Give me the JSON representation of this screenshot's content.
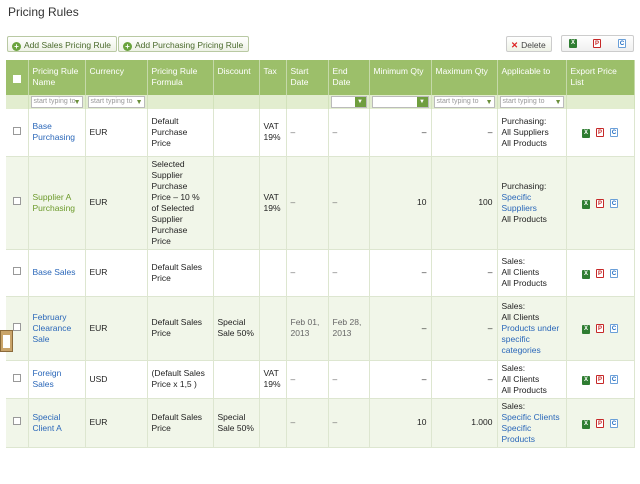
{
  "page": {
    "title": "Pricing Rules"
  },
  "toolbar": {
    "add_sales": "Add Sales Pricing Rule",
    "add_purchasing": "Add Purchasing Pricing Rule",
    "delete": "Delete",
    "export_icons": [
      "excel-icon",
      "pdf-icon",
      "csv-icon"
    ]
  },
  "table": {
    "headers": [
      "Pricing Rule Name",
      "Currency",
      "Pricing Rule Formula",
      "Discount",
      "Tax",
      "Start Date",
      "End Date",
      "Minimum Qty",
      "Maximum Qty",
      "Applicable to",
      "Export Price List"
    ],
    "filter_placeholder": "start typing to",
    "rows": [
      {
        "name": "Base Purchasing",
        "currency": "EUR",
        "formula": "Default Purchase Price",
        "discount": "",
        "tax": "VAT 19%",
        "start": "–",
        "end": "–",
        "min": "–",
        "max": "–",
        "app_type": "Purchasing:",
        "app_lines": [
          {
            "text": "All Suppliers",
            "link": false
          },
          {
            "text": "All Products",
            "link": false
          }
        ]
      },
      {
        "name": "Supplier A Purchasing",
        "currency": "EUR",
        "formula": "Selected Supplier Purchase Price – 10 % of Selected Supplier Purchase Price",
        "discount": "",
        "tax": "VAT 19%",
        "start": "–",
        "end": "–",
        "min": "10",
        "max": "100",
        "app_type": "Purchasing:",
        "app_lines": [
          {
            "text": "Specific Suppliers",
            "link": true
          },
          {
            "text": "All Products",
            "link": false
          }
        ]
      },
      {
        "name": "Base Sales",
        "currency": "EUR",
        "formula": "Default Sales Price",
        "discount": "",
        "tax": "",
        "start": "–",
        "end": "–",
        "min": "–",
        "max": "–",
        "app_type": "Sales:",
        "app_lines": [
          {
            "text": "All Clients",
            "link": false
          },
          {
            "text": "All Products",
            "link": false
          }
        ]
      },
      {
        "name": "February Clearance Sale",
        "currency": "EUR",
        "formula": "Default Sales Price",
        "discount": "Special Sale 50%",
        "tax": "",
        "start": "Feb 01, 2013",
        "end": "Feb 28, 2013",
        "min": "–",
        "max": "–",
        "app_type": "Sales:",
        "app_lines": [
          {
            "text": "All Clients",
            "link": false
          },
          {
            "text": "Products under specific categories",
            "link": true
          }
        ]
      },
      {
        "name": "Foreign Sales",
        "currency": "USD",
        "formula": "(Default Sales Price x 1,5 )",
        "discount": "",
        "tax": "VAT 19%",
        "start": "–",
        "end": "–",
        "min": "–",
        "max": "–",
        "app_type": "Sales:",
        "app_lines": [
          {
            "text": "All Clients",
            "link": false
          },
          {
            "text": "All Products",
            "link": false
          }
        ]
      },
      {
        "name": "Special Client A",
        "currency": "EUR",
        "formula": "Default Sales Price",
        "discount": "Special Sale 50%",
        "tax": "",
        "start": "–",
        "end": "–",
        "min": "10",
        "max": "1.000",
        "app_type": "Sales:",
        "app_lines": [
          {
            "text": "Specific Clients",
            "link": true
          },
          {
            "text": "Specific Products",
            "link": true
          }
        ]
      }
    ]
  }
}
